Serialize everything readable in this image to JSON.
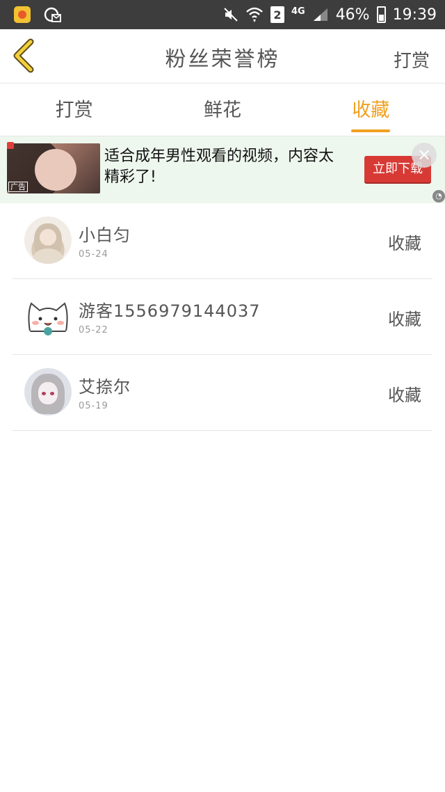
{
  "status_bar": {
    "battery": "46%",
    "time": "19:39",
    "sim_slot": "2",
    "network": "4G"
  },
  "header": {
    "title": "粉丝荣誉榜",
    "action": "打赏"
  },
  "tabs": [
    {
      "label": "打赏",
      "active": false
    },
    {
      "label": "鲜花",
      "active": false
    },
    {
      "label": "收藏",
      "active": true
    }
  ],
  "ad": {
    "text": "适合成年男性观看的视频，内容太精彩了!",
    "button": "立即下载",
    "thumb_tag": "广告"
  },
  "fans": [
    {
      "name": "小白匀",
      "date": "05-24",
      "kind": "收藏",
      "avatar": "girl-avatar"
    },
    {
      "name": "游客1556979144037",
      "date": "05-22",
      "kind": "收藏",
      "avatar": "cat-avatar"
    },
    {
      "name": "艾捺尔",
      "date": "05-19",
      "kind": "收藏",
      "avatar": "anime-avatar"
    }
  ],
  "colors": {
    "accent": "#f0a020",
    "status_bar": "#3d3d3d",
    "ad_button": "#d73a35"
  }
}
